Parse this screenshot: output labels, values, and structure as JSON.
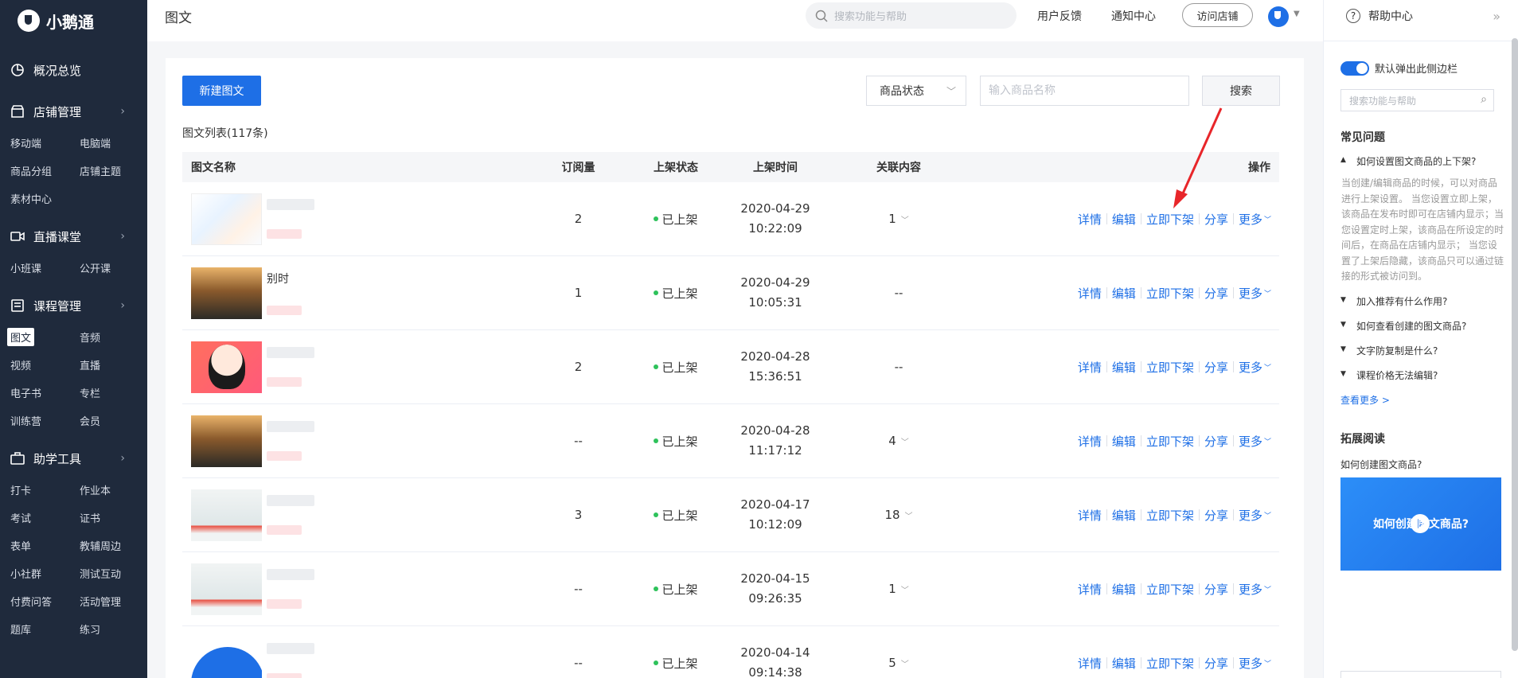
{
  "brand": {
    "name": "小鹅通"
  },
  "sidebar": {
    "groups": [
      {
        "label": "概况总览",
        "icon": "pie-chart-icon",
        "items": []
      },
      {
        "label": "店铺管理",
        "icon": "store-icon",
        "items": [
          "移动端",
          "电脑端",
          "商品分组",
          "店铺主题",
          "素材中心"
        ]
      },
      {
        "label": "直播课堂",
        "icon": "video-camera-icon",
        "items": [
          "小班课",
          "公开课"
        ]
      },
      {
        "label": "课程管理",
        "icon": "book-icon",
        "items": [
          "图文",
          "音频",
          "视频",
          "直播",
          "电子书",
          "专栏",
          "训练营",
          "会员"
        ]
      },
      {
        "label": "助学工具",
        "icon": "toolbox-icon",
        "items": [
          "打卡",
          "作业本",
          "考试",
          "证书",
          "表单",
          "教辅周边",
          "小社群",
          "测试互动",
          "付费问答",
          "活动管理",
          "题库",
          "练习"
        ]
      }
    ],
    "active_item": "图文"
  },
  "header": {
    "title": "图文",
    "search_placeholder": "搜索功能与帮助",
    "feedback": "用户反馈",
    "notifications": "通知中心",
    "visit_store": "访问店铺"
  },
  "toolbar": {
    "new_button": "新建图文",
    "status_select": "商品状态",
    "name_placeholder": "输入商品名称",
    "search_button": "搜索"
  },
  "list": {
    "count_label": "图文列表(117条)",
    "columns": [
      "图文名称",
      "订阅量",
      "上架状态",
      "上架时间",
      "关联内容",
      "操作"
    ],
    "rows": [
      {
        "name": "",
        "subs": "2",
        "status": "已上架",
        "date": "2020-04-29",
        "time": "10:22:09",
        "related": "1",
        "has_caret": true
      },
      {
        "name": "别时",
        "subs": "1",
        "status": "已上架",
        "date": "2020-04-29",
        "time": "10:05:31",
        "related": "--",
        "has_caret": false
      },
      {
        "name": "",
        "subs": "2",
        "status": "已上架",
        "date": "2020-04-28",
        "time": "15:36:51",
        "related": "--",
        "has_caret": false
      },
      {
        "name": "",
        "subs": "--",
        "status": "已上架",
        "date": "2020-04-28",
        "time": "11:17:12",
        "related": "4",
        "has_caret": true
      },
      {
        "name": "",
        "subs": "3",
        "status": "已上架",
        "date": "2020-04-17",
        "time": "10:12:09",
        "related": "18",
        "has_caret": true
      },
      {
        "name": "",
        "subs": "--",
        "status": "已上架",
        "date": "2020-04-15",
        "time": "09:26:35",
        "related": "1",
        "has_caret": true
      },
      {
        "name": "",
        "subs": "--",
        "status": "已上架",
        "date": "2020-04-14",
        "time": "09:14:38",
        "related": "5",
        "has_caret": true
      }
    ],
    "ops": {
      "detail": "详情",
      "edit": "编辑",
      "unpublish": "立即下架",
      "share": "分享",
      "more": "更多"
    }
  },
  "help": {
    "title": "帮助中心",
    "toggle_label": "默认弹出此侧边栏",
    "search_placeholder": "搜索功能与帮助",
    "faq_title": "常见问题",
    "faq": [
      "如何设置图文商品的上下架?",
      "加入推荐有什么作用?",
      "如何查看创建的图文商品?",
      "文字防复制是什么?",
      "课程价格无法编辑?"
    ],
    "faq_answer": "当创建/编辑商品的时候，可以对商品进行上架设置。 当您设置立即上架，该商品在发布时即可在店铺内显示；当您设置定时上架，该商品在所设定的时间后，在商品在店铺内显示； 当您设置了上架后隐藏，该商品只可以通过链接的形式被访问到。",
    "see_more": "查看更多 >",
    "ext_title": "拓展阅读",
    "ext_link": "如何创建图文商品?",
    "video_title": "如何创建图文商品?"
  }
}
